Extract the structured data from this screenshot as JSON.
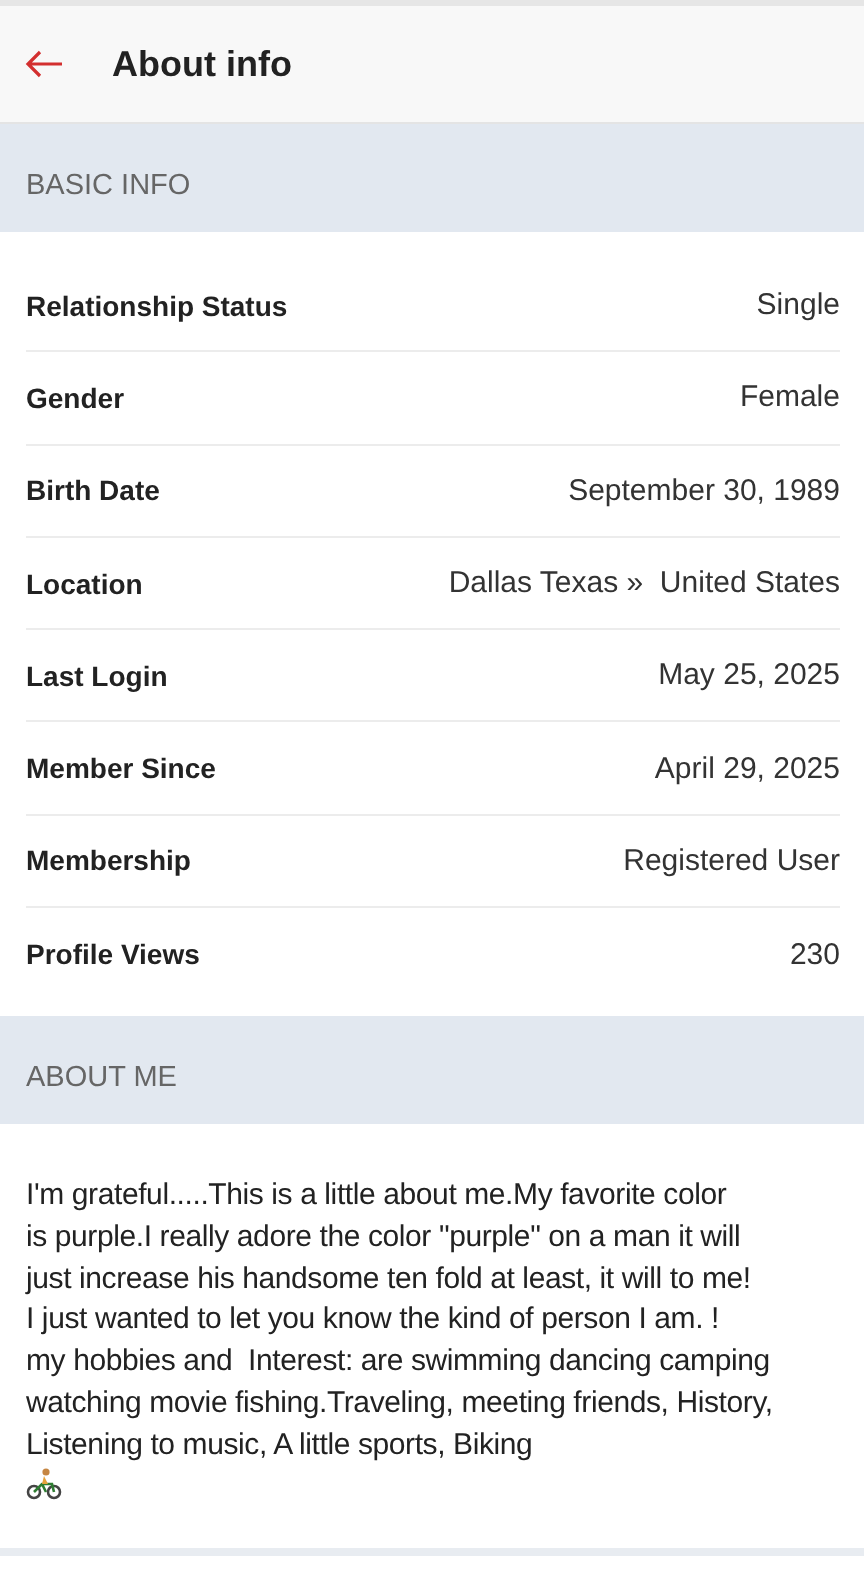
{
  "header": {
    "title": "About info"
  },
  "basic_info": {
    "heading": "BASIC INFO",
    "rows": [
      {
        "label": "Relationship Status",
        "value": "Single"
      },
      {
        "label": "Gender",
        "value": "Female"
      },
      {
        "label": "Birth Date",
        "value": "September 30, 1989"
      },
      {
        "label": "Location",
        "value": "Dallas Texas »  United States"
      },
      {
        "label": "Last Login",
        "value": "May 25, 2025"
      },
      {
        "label": "Member Since",
        "value": "April 29, 2025"
      },
      {
        "label": "Membership",
        "value": "Registered User"
      },
      {
        "label": "Profile Views",
        "value": "230"
      }
    ]
  },
  "about_me": {
    "heading": "ABOUT ME",
    "text": "I'm grateful.....This is a little about me.My favorite color\nis purple.I really adore the color \"purple\" on a man it will\njust increase his handsome ten fold at least, it will to me!\nI just wanted to let you know the kind of person I am. !\nmy hobbies and  Interest: are swimming dancing camping\nwatching movie fishing.Traveling, meeting friends, History,\nListening to music, A little sports, Biking"
  }
}
